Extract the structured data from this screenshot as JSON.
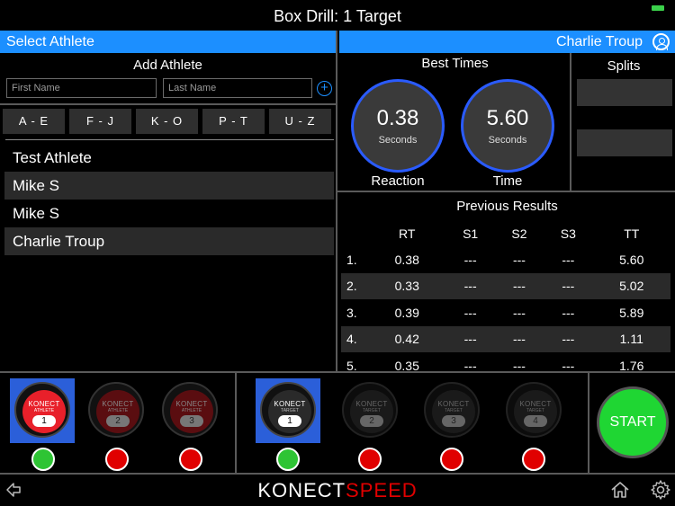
{
  "title": "Box Drill: 1 Target",
  "left_header": "Select Athlete",
  "right_header": "Charlie Troup",
  "add_athlete": {
    "title": "Add Athlete",
    "first_placeholder": "First Name",
    "last_placeholder": "Last Name",
    "add_symbol": "+"
  },
  "alpha_filters": [
    "A - E",
    "F - J",
    "K - O",
    "P - T",
    "U - Z"
  ],
  "athletes": [
    "Test Athlete",
    "Mike S",
    "Mike S",
    "Charlie Troup"
  ],
  "best_times": {
    "title": "Best Times",
    "reaction": {
      "value": "0.38",
      "unit": "Seconds",
      "label": "Reaction"
    },
    "time": {
      "value": "5.60",
      "unit": "Seconds",
      "label": "Time"
    }
  },
  "splits_title": "Splits",
  "previous_results": {
    "title": "Previous Results",
    "columns": [
      "",
      "RT",
      "S1",
      "S2",
      "S3",
      "TT"
    ],
    "rows": [
      [
        "1.",
        "0.38",
        "---",
        "---",
        "---",
        "5.60"
      ],
      [
        "2.",
        "0.33",
        "---",
        "---",
        "---",
        "5.02"
      ],
      [
        "3.",
        "0.39",
        "---",
        "---",
        "---",
        "5.89"
      ],
      [
        "4.",
        "0.42",
        "---",
        "---",
        "---",
        "1.11"
      ],
      [
        "5.",
        "0.35",
        "---",
        "---",
        "---",
        "1.76"
      ]
    ]
  },
  "athlete_sensors": {
    "brand": "KONECT",
    "sub": "ATHLETE",
    "numbers": [
      "1",
      "2",
      "3"
    ]
  },
  "target_sensors": {
    "brand": "KONECT",
    "sub": "TARGET",
    "numbers": [
      "1",
      "2",
      "3",
      "4"
    ]
  },
  "start_label": "START",
  "footer": {
    "logo_a": "KONECT",
    "logo_b": "SPEED"
  },
  "colors": {
    "accent": "#1c8fff",
    "selected": "#2b5fd9",
    "go": "#1fd633",
    "stop": "#e00000"
  }
}
